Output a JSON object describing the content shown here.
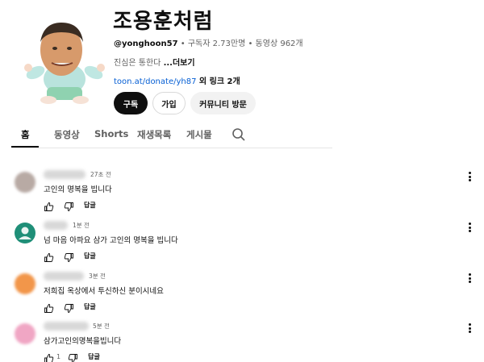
{
  "channel": {
    "name": "조용훈처럼",
    "handle": "@yonghoon57",
    "sep1": " • ",
    "subscribers": "구독자 2.73만명",
    "sep2": " • ",
    "videos": "동영상 962개",
    "description": "진심은 통한다 ",
    "more": "...더보기",
    "link": "toon.at/donate/yh87",
    "links_extra": " 외 링크 2개"
  },
  "buttons": {
    "subscribe": "구독",
    "join": "가입",
    "community": "커뮤니티 방문"
  },
  "tabs": [
    "홈",
    "동영상",
    "Shorts",
    "재생목록",
    "게시물"
  ],
  "comments": [
    {
      "time": "27초 전",
      "text": "고인의 명복을 빕니다",
      "likes": "",
      "reply": "답글",
      "avatar_color": "#b8aaa4"
    },
    {
      "time": "1분 전",
      "text": "넘 마음 아파요 삼가 고인의 명복을 빕니다",
      "likes": "",
      "reply": "답글",
      "avatar_color": "#1f8f78"
    },
    {
      "time": "3분 전",
      "text": "저희집 옥상에서 투신하신 분이시네요",
      "likes": "",
      "reply": "답글",
      "avatar_color": "#f2964a"
    },
    {
      "time": "5분 전",
      "text": "삼가고인의명복을빕니다",
      "likes": "1",
      "reply": "답글",
      "avatar_color": "#f0a6c4"
    }
  ],
  "icons": {
    "search": "search-icon",
    "like": "thumbs-up-icon",
    "dislike": "thumbs-down-icon",
    "more": "more-vert-icon"
  }
}
